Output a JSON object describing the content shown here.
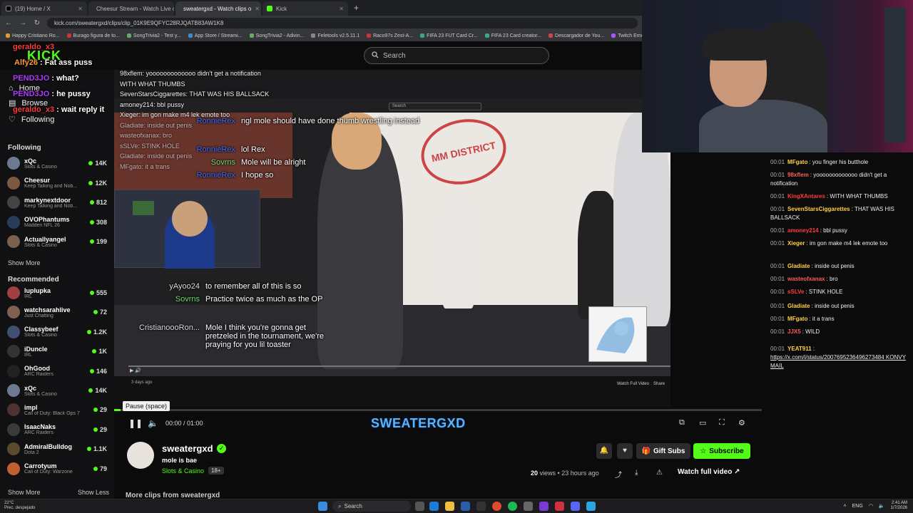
{
  "browser": {
    "tabs": [
      {
        "label": "(19) Home / X",
        "active": false
      },
      {
        "label": "Cheesur Stream - Watch Live o",
        "active": false
      },
      {
        "label": "sweatergxd - Watch clips o",
        "active": true
      },
      {
        "label": "Kick",
        "active": false
      }
    ],
    "url": "kick.com/sweatergxd/clips/clip_01K9E9QFYC28RJQATB83AW1K8",
    "bookmarks": [
      "Happy Cristiano Ro...",
      "Burago figura de to...",
      "SongTrivia2 - Test y...",
      "App Store / Streami...",
      "SongTrivia2 - Adivin...",
      "Feletools v2.5.11.1",
      "Raco97s Zest-A...",
      "FIFA 23 FUT Card Cr...",
      "FIFA 23 Card creator...",
      "Descargador de You...",
      "Twitch Emote Resizer",
      "twitch em"
    ]
  },
  "header": {
    "logo": "KICK",
    "search_placeholder": "Search"
  },
  "sidebar": {
    "nav": [
      {
        "label": "Home"
      },
      {
        "label": "Browse"
      },
      {
        "label": "Following"
      }
    ],
    "following_title": "Following",
    "following": [
      {
        "name": "xQc",
        "category": "Slots & Casino",
        "viewers": "14K",
        "color": "#6b7a8f"
      },
      {
        "name": "Cheesur",
        "category": "Keep Talking and Nob...",
        "viewers": "12K",
        "color": "#7a5a40"
      },
      {
        "name": "markynextdoor",
        "category": "Keep Talking and Nob...",
        "viewers": "812",
        "color": "#444"
      },
      {
        "name": "OVOPhantums",
        "category": "Madden NFL 26",
        "viewers": "308",
        "color": "#2a3a5a"
      },
      {
        "name": "Actuallyangel",
        "category": "Slots & Casino",
        "viewers": "199",
        "color": "#7a6050"
      }
    ],
    "show_more": "Show More",
    "recommended_title": "Recommended",
    "recommended": [
      {
        "name": "luplupka",
        "category": "IRL",
        "viewers": "555",
        "color": "#a04040"
      },
      {
        "name": "watchsarahlive",
        "category": "Just Chatting",
        "viewers": "72",
        "color": "#806050"
      },
      {
        "name": "Classybeef",
        "category": "Slots & Casino",
        "viewers": "1.2K",
        "color": "#405070"
      },
      {
        "name": "iDuncle",
        "category": "IRL",
        "viewers": "1K",
        "color": "#333"
      },
      {
        "name": "OhGood",
        "category": "ARC Raiders",
        "viewers": "146",
        "color": "#222"
      },
      {
        "name": "xQc",
        "category": "Slots & Casino",
        "viewers": "14K",
        "color": "#6b7a8f"
      },
      {
        "name": "impl",
        "category": "Call of Duty: Black Ops 7",
        "viewers": "29",
        "color": "#503030"
      },
      {
        "name": "IsaacNaks",
        "category": "ARC Raiders",
        "viewers": "29",
        "color": "#3a3a3a"
      },
      {
        "name": "AdmiralBulldog",
        "category": "Dota 2",
        "viewers": "1.1K",
        "color": "#5a4a30"
      },
      {
        "name": "Carrotyum",
        "category": "Call of Duty: Warzone",
        "viewers": "79",
        "color": "#c06030"
      }
    ],
    "show_more_2": "Show More",
    "show_less": "Show Less"
  },
  "overlay_chat": [
    {
      "user": "geraldo_x3",
      "text": "",
      "color": "#ff3b3b"
    },
    {
      "user": "Alfy26",
      "text": ": Fat ass puss",
      "color": "#ff9a3b"
    },
    {
      "user": "PEND3JO",
      "text": ": what?",
      "color": "#b03bff"
    },
    {
      "user": "PEND3JO",
      "text": ": he pussy",
      "color": "#b03bff"
    },
    {
      "user": "geraldo_x3",
      "text": ": wait reply it",
      "color": "#ff3b3b"
    }
  ],
  "video_chat": [
    {
      "name": "RonnieRex",
      "text": "ngl mole should have done thumb wrestling instead"
    },
    {
      "name": "RonnieRex",
      "text": "lol Rex"
    },
    {
      "name": "Sovrns",
      "text": "Mole will be alright"
    },
    {
      "name": "RonnieRex",
      "text": "I hope so"
    },
    {
      "name": "yAyoo24",
      "text": "to remember all of this is so"
    },
    {
      "name": "Sovrns",
      "text": "Practice twice as much as the OP"
    },
    {
      "name": "CristianoooRon...",
      "text": "Mole I think you're gonna get pretzeled in the tournament, we're praying for you lil toaster"
    }
  ],
  "video_inner_top": [
    {
      "text": "98xflem: yooooooooooooo didn't get a notification"
    },
    {
      "text": "WITH WHAT THUMBS"
    },
    {
      "text": "SevenStarsCiggarettes: THAT WAS HIS BALLSACK"
    },
    {
      "text": "amoney214: bbl pussy"
    },
    {
      "text": "Xieger: im gon make m4 lek emote too"
    },
    {
      "text": "Gladiate: inside out penis"
    },
    {
      "text": "wasteofxanax: bro"
    },
    {
      "text": "sSLVe: STINK HOLE"
    },
    {
      "text": "Gladiate: inside out penis"
    },
    {
      "text": "MFgato: it a trans"
    }
  ],
  "video_misc": {
    "stamp": "MM DISTRICT",
    "inner_search": "Search",
    "inner_upload": "3 days ago",
    "inner_watch": "Watch Full Video",
    "inner_share": "Share"
  },
  "player": {
    "tooltip": "Pause (space)",
    "time": "00:00 / 01:00",
    "progress": 0.01,
    "overlay_banner": "SWEATERGXD"
  },
  "clip": {
    "channel": "sweatergxd",
    "title": "mole is bae",
    "category": "Slots & Casino",
    "age": "18+",
    "views_count": "20",
    "views_label": "views",
    "posted": "23 hours ago",
    "gift_subs": "Gift Subs",
    "subscribe": "Subscribe",
    "watch_full": "Watch full video",
    "more_clips": "More clips from sweatergxd"
  },
  "chat": [
    {
      "time": "00:01",
      "user": "MFgato",
      "color": "#ffd24a",
      "text": "you finger his butthole"
    },
    {
      "time": "00:01",
      "user": "98xflem",
      "color": "#ff5b5b",
      "text": "yooooooooooooo didn't get a notification"
    },
    {
      "time": "00:01",
      "user": "KingXAntares",
      "color": "#ff3b3b",
      "text": "WITH WHAT THUMBS"
    },
    {
      "time": "00:01",
      "user": "SevenStarsCiggarettes",
      "color": "#ffd24a",
      "text": "THAT WAS HIS BALLSACK"
    },
    {
      "time": "00:01",
      "user": "amoney214",
      "color": "#ff3b3b",
      "text": "bbl pussy"
    },
    {
      "time": "00:01",
      "user": "Xieger",
      "color": "#ffd24a",
      "text": "im gon make m4 lek emote too"
    },
    {
      "time": "00:01",
      "user": "Gladiate",
      "color": "#ffd24a",
      "text": "inside out penis"
    },
    {
      "time": "00:01",
      "user": "wasteofxanax",
      "color": "#ff5b5b",
      "text": "bro"
    },
    {
      "time": "00:01",
      "user": "sSLVe",
      "color": "#ff3b3b",
      "text": "STINK HOLE"
    },
    {
      "time": "00:01",
      "user": "Gladiate",
      "color": "#ffd24a",
      "text": "inside out penis"
    },
    {
      "time": "00:01",
      "user": "MFgato",
      "color": "#ffd24a",
      "text": "it a trans"
    },
    {
      "time": "00:01",
      "user": "JJX5",
      "color": "#ff5b5b",
      "text": "WILD"
    },
    {
      "time": "00:01",
      "user": "YEAT911",
      "color": "#ffd24a",
      "text": "https://x.com/i/status/2007695236496273484 KONVY MAIL"
    }
  ],
  "taskbar": {
    "weather_temp": "22°C",
    "weather_desc": "Prec. despejado",
    "search": "Search",
    "lang": "ENG",
    "time": "2:41 AM",
    "date": "1/7/2026"
  },
  "colors": {
    "accent": "#53fc18",
    "background": "#0b0b0c",
    "banner": "#5ab3ff"
  }
}
